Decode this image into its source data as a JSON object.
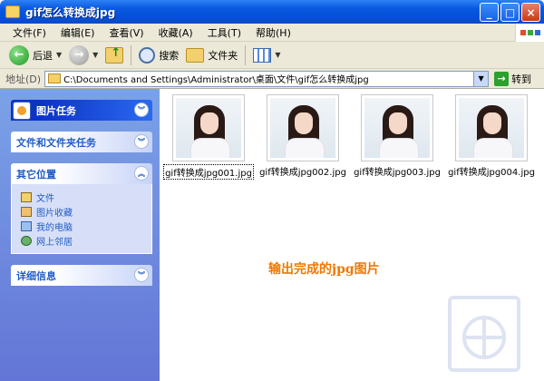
{
  "window": {
    "title": "gif怎么转换成jpg"
  },
  "menubar": {
    "items": [
      "文件(F)",
      "编辑(E)",
      "查看(V)",
      "收藏(A)",
      "工具(T)",
      "帮助(H)"
    ]
  },
  "toolbar": {
    "back_label": "后退",
    "search_label": "搜索",
    "folders_label": "文件夹"
  },
  "address": {
    "label": "地址(D)",
    "path": "C:\\Documents and Settings\\Administrator\\桌面\\文件\\gif怎么转换成jpg",
    "go_label": "转到"
  },
  "taskpane": {
    "picture_tasks": "图片任务",
    "file_folder_tasks": "文件和文件夹任务",
    "other_places": {
      "title": "其它位置",
      "items": [
        "文件",
        "图片收藏",
        "我的电脑",
        "网上邻居"
      ]
    },
    "details": "详细信息"
  },
  "files": [
    {
      "name": "gif转换成jpg001.jpg"
    },
    {
      "name": "gif转换成jpg002.jpg"
    },
    {
      "name": "gif转换成jpg003.jpg"
    },
    {
      "name": "gif转换成jpg004.jpg"
    }
  ],
  "annotation": "输出完成的jpg图片",
  "colors": {
    "accent": "#f07800",
    "titlebar": "#0a5ae0",
    "taskpane": "#7ba2e7"
  }
}
